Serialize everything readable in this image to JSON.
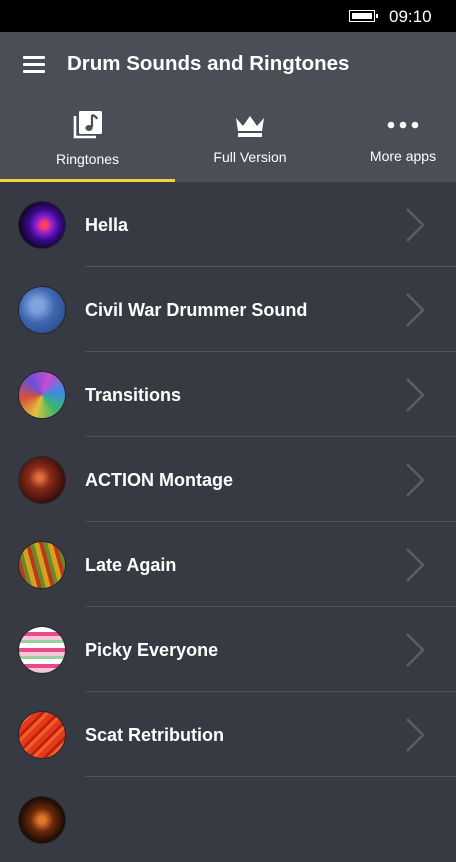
{
  "status_bar": {
    "time": "09:10",
    "battery_icon": "battery-full-icon"
  },
  "header": {
    "title": "Drum Sounds and Ringtones",
    "menu_icon": "hamburger-menu-icon"
  },
  "tabs": [
    {
      "label": "Ringtones",
      "icon": "music-library-icon",
      "selected": true
    },
    {
      "label": "Full Version",
      "icon": "crown-icon",
      "selected": false
    },
    {
      "label": "More apps",
      "icon": "more-dots-icon",
      "selected": false
    }
  ],
  "ringtones": [
    {
      "title": "Hella"
    },
    {
      "title": "Civil War Drummer Sound"
    },
    {
      "title": "Transitions"
    },
    {
      "title": "ACTION Montage"
    },
    {
      "title": "Late Again"
    },
    {
      "title": "Picky Everyone"
    },
    {
      "title": "Scat Retribution"
    }
  ],
  "colors": {
    "background": "#373a42",
    "app_bar": "#4b4e57",
    "accent": "#f2d23a",
    "divider": "#50535b",
    "chevron": "#5a5d66"
  }
}
